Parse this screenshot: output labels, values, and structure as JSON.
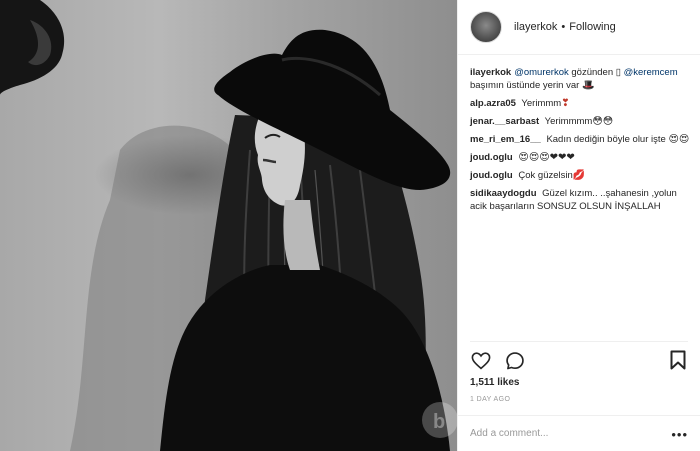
{
  "post_header": {
    "username": "ilayerkok",
    "separator": "•",
    "follow_status": "Following"
  },
  "comments": [
    {
      "user": "ilayerkok",
      "mention1": "@omurerkok",
      "text1": " gözünden ▯ ",
      "mention2": "@keremcem",
      "text2": " başımın üstünde yerin var ",
      "emoji": "🎩"
    },
    {
      "user": "alp.azra05",
      "text": "Yerimmm",
      "emoji": "❣"
    },
    {
      "user": "jenar.__sarbast",
      "text": "Yerimmmm",
      "emoji": "😳😳"
    },
    {
      "user": "me_ri_em_16__",
      "text": "Kadın dediğin böyle olur işte",
      "emoji": "😍😍"
    },
    {
      "user": "joud.oglu",
      "text": "",
      "emoji": "😍😍😍❤❤❤"
    },
    {
      "user": "joud.oglu",
      "text": "Çok güzelsin",
      "emoji": "💋"
    },
    {
      "user": "sidikaaydogdu",
      "text": "Güzel kızım.. ..şahanesin ,yolun acik başarıların SONSUZ OLSUN İNŞALLAH"
    }
  ],
  "icons": {
    "heart": "heart-icon",
    "comment": "comment-icon",
    "bookmark": "bookmark-icon",
    "more": "more-options-icon"
  },
  "likes": "1,511 likes",
  "date": "1 DAY AGO",
  "add_comment": {
    "placeholder": "Add a comment...",
    "more_label": "•••"
  }
}
